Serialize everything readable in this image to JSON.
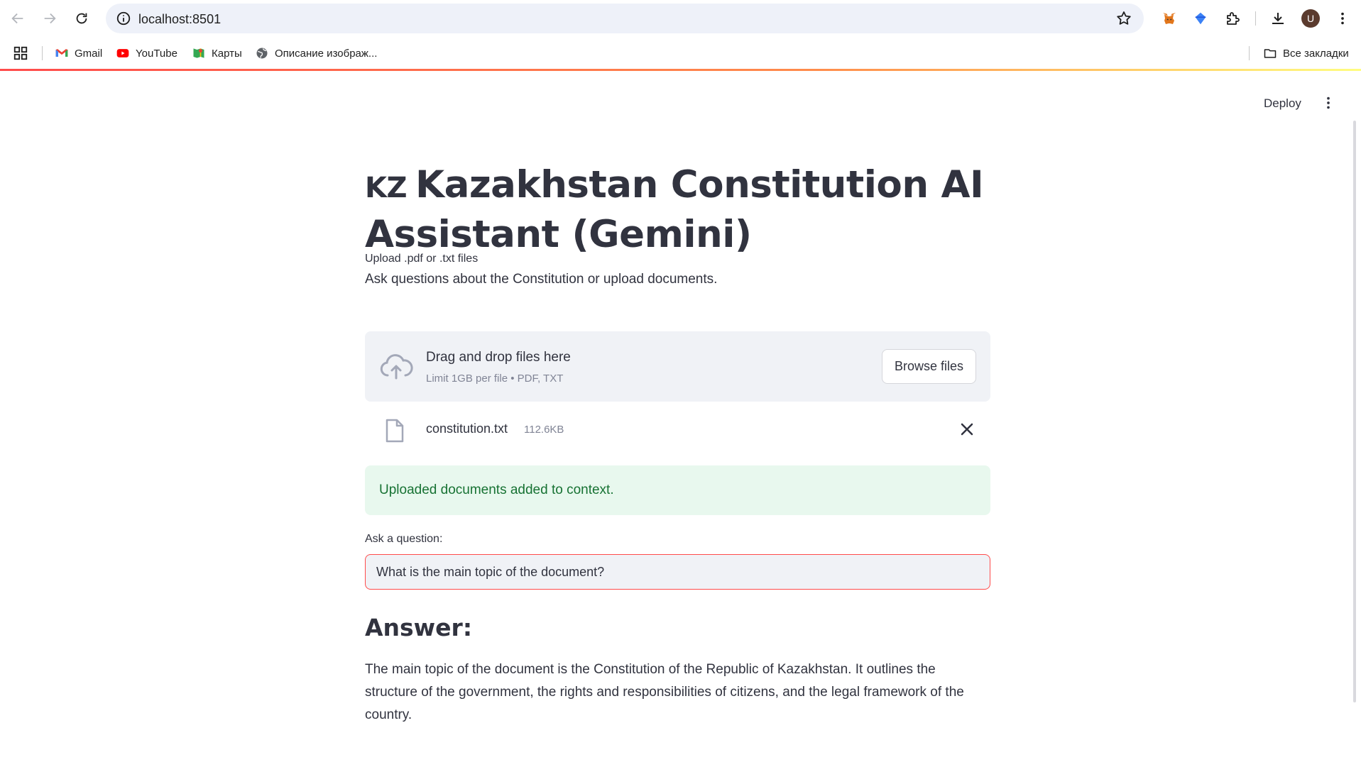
{
  "browser": {
    "url": "localhost:8501",
    "bookmarks": [
      {
        "label": "Gmail",
        "icon": "gmail-icon"
      },
      {
        "label": "YouTube",
        "icon": "youtube-icon"
      },
      {
        "label": "Карты",
        "icon": "maps-icon"
      },
      {
        "label": "Описание изображ...",
        "icon": "globe-icon"
      }
    ],
    "all_bookmarks_label": "Все закладки",
    "avatar_letter": "U"
  },
  "app": {
    "deploy_label": "Deploy",
    "title_flag": "KZ",
    "title": "Kazakhstan Constitution AI Assistant (Gemini)",
    "subtitle": "Ask questions about the Constitution or upload documents.",
    "upload": {
      "label": "Upload .pdf or .txt files",
      "drop_title": "Drag and drop files here",
      "drop_limit": "Limit 1GB per file • PDF, TXT",
      "browse_label": "Browse files"
    },
    "file": {
      "name": "constitution.txt",
      "size": "112.6KB"
    },
    "success_message": "Uploaded documents added to context.",
    "question": {
      "label": "Ask a question:",
      "value": "What is the main topic of the document?"
    },
    "answer": {
      "heading": "Answer:",
      "text": "The main topic of the document is the Constitution of the Republic of Kazakhstan. It outlines the structure of the government, the rights and responsibilities of citizens, and the legal framework of the country."
    },
    "colors": {
      "accent": "#ff4b4b",
      "success_bg": "#e8f8ee",
      "success_text": "#177233",
      "dropzone_bg": "#f0f2f6",
      "text": "#31333f"
    }
  }
}
